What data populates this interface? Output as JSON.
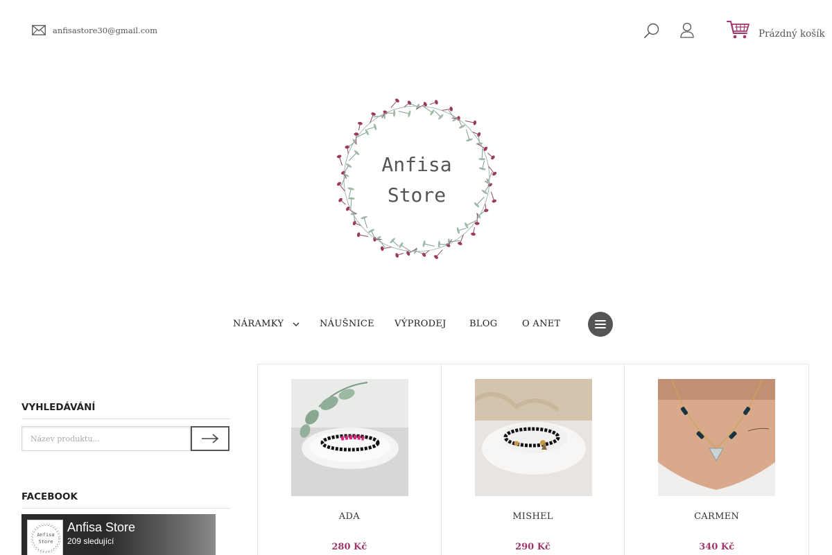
{
  "header": {
    "email": "anfisastore30@gmail.com",
    "cart_label": "Prázdný košík"
  },
  "logo": {
    "line1": "Anfisa",
    "line2": "Store"
  },
  "nav": {
    "items": [
      {
        "label": "NÁRAMKY"
      },
      {
        "label": "NÁUŠNICE"
      },
      {
        "label": "VÝPRODEJ"
      },
      {
        "label": "BLOG"
      },
      {
        "label": "O ANET"
      }
    ]
  },
  "sidebar": {
    "search_heading": "VYHLEDÁVÁNÍ",
    "search_placeholder": "Název produktu...",
    "facebook_heading": "FACEBOOK",
    "facebook_page_name": "Anfisa Store",
    "facebook_followers": "209 sledující",
    "facebook_thumb_line1": "Anfisa",
    "facebook_thumb_line2": "Store"
  },
  "products": [
    {
      "name": "ADA",
      "price": "280 Kč"
    },
    {
      "name": "MISHEL",
      "price": "290 Kč"
    },
    {
      "name": "CARMEN",
      "price": "340 Kč"
    }
  ],
  "colors": {
    "accent": "#a0356b",
    "dark": "#555555"
  }
}
